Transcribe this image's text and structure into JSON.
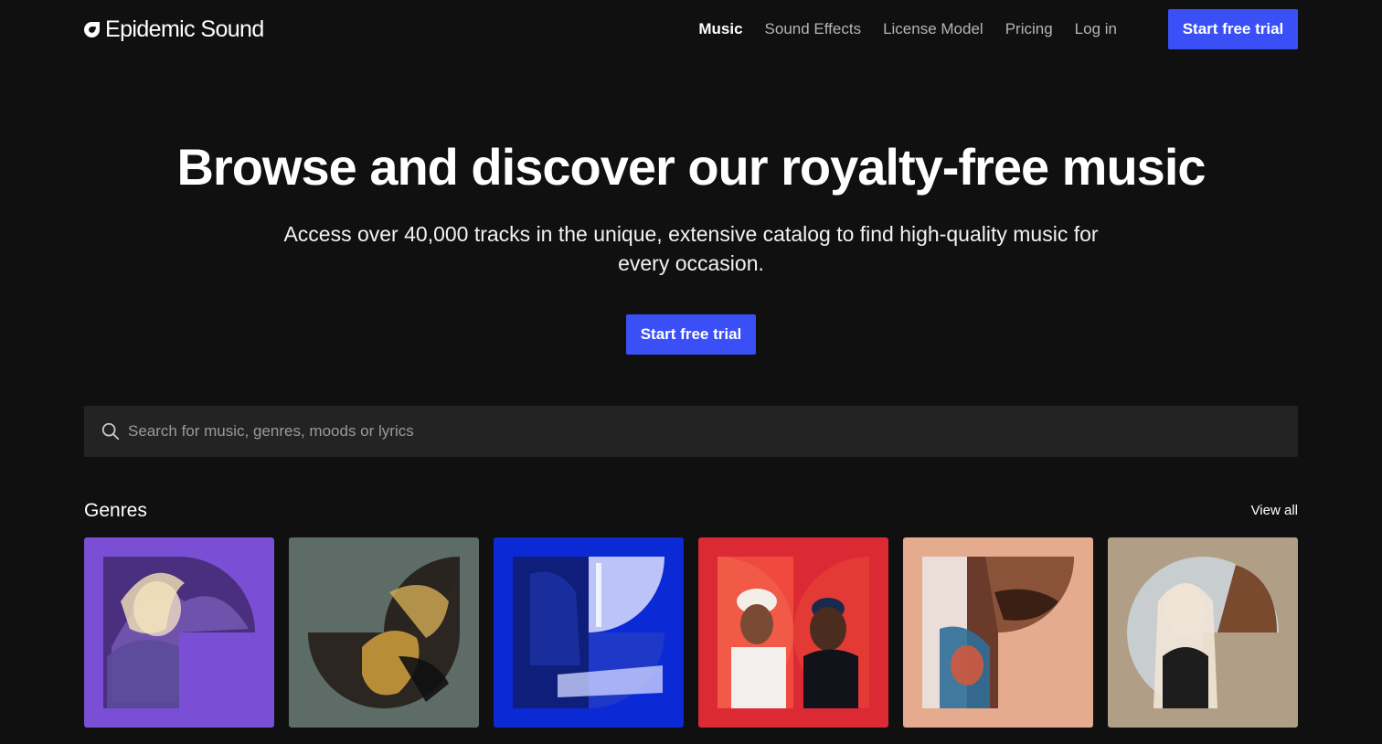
{
  "header": {
    "logo_text": "Epidemic Sound",
    "nav": [
      {
        "label": "Music",
        "active": true
      },
      {
        "label": "Sound Effects",
        "active": false
      },
      {
        "label": "License Model",
        "active": false
      },
      {
        "label": "Pricing",
        "active": false
      },
      {
        "label": "Log in",
        "active": false
      }
    ],
    "cta_label": "Start free trial"
  },
  "hero": {
    "title": "Browse and discover our royalty-free music",
    "subtitle": "Access over 40,000 tracks in the unique, extensive catalog to find high-quality music for every occasion.",
    "cta_label": "Start free trial"
  },
  "search": {
    "placeholder": "Search for music, genres, moods or lyrics",
    "value": ""
  },
  "genres": {
    "title": "Genres",
    "view_all_label": "View all",
    "cards": [
      {
        "bg": "#7a4fd6"
      },
      {
        "bg": "#5d6c66"
      },
      {
        "bg": "#0b2ad6"
      },
      {
        "bg": "#dc2a34"
      },
      {
        "bg": "#e5ab8f"
      },
      {
        "bg": "#b09f86"
      }
    ]
  },
  "colors": {
    "background": "#101010",
    "accent": "#3b4ff7",
    "search_bg": "#232323"
  }
}
